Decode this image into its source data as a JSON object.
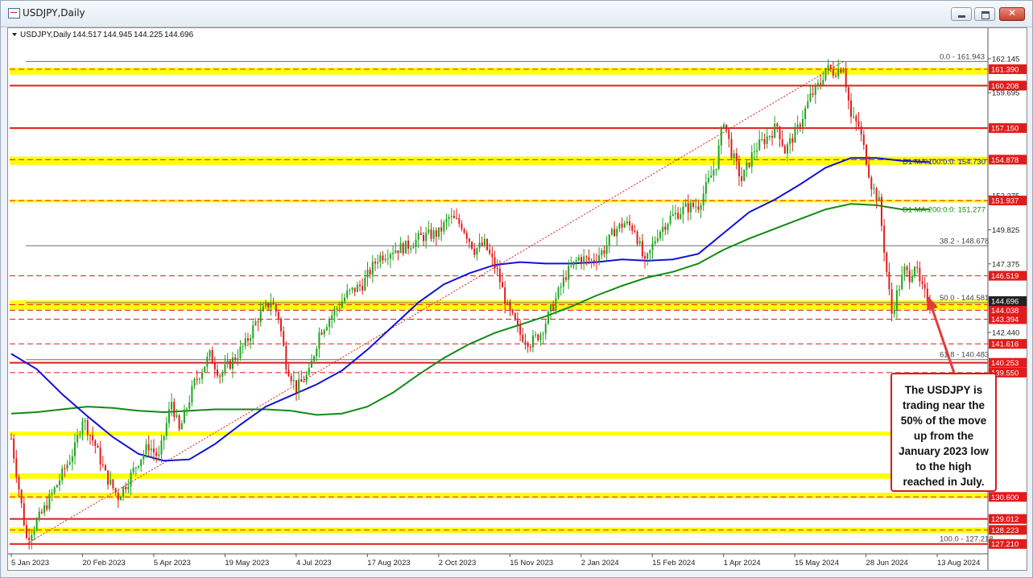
{
  "window": {
    "title": "USDJPY,Daily",
    "controls": {
      "minimize": "minimize",
      "maximize": "maximize",
      "close": "✕"
    }
  },
  "chart_data": {
    "type": "candlestick",
    "symbol": "USDJPY,Daily",
    "ohlc_header": [
      "144.517",
      "144.945",
      "144.225",
      "144.696"
    ],
    "colors": {
      "up": "#1fa41f",
      "down": "#e01b1b",
      "ma100": "#1212d6",
      "ma200": "#138a13",
      "hline": "#e41a1a",
      "zone": "#ffff00",
      "fib": "#6e6e6e"
    },
    "x_ticks": [
      "5 Jan 2023",
      "20 Feb 2023",
      "5 Apr 2023",
      "19 May 2023",
      "4 Jul 2023",
      "17 Aug 2023",
      "2 Oct 2023",
      "15 Nov 2023",
      "2 Jan 2024",
      "15 Feb 2024",
      "1 Apr 2024",
      "15 May 2024",
      "28 Jun 2024",
      "13 Aug 2024"
    ],
    "y_ticks": [
      "162.145",
      "159.695",
      "152.275",
      "149.825",
      "147.375",
      "142.440"
    ],
    "ylim": [
      126.5,
      163.3
    ],
    "price_path": [
      {
        "t": 0,
        "p": 134.8
      },
      {
        "t": 3,
        "p": 131.2
      },
      {
        "t": 6,
        "p": 127.6
      },
      {
        "t": 12,
        "p": 129.4
      },
      {
        "t": 18,
        "p": 131.5
      },
      {
        "t": 25,
        "p": 134.1
      },
      {
        "t": 28,
        "p": 136.3
      },
      {
        "t": 33,
        "p": 134.3
      },
      {
        "t": 37,
        "p": 132.2
      },
      {
        "t": 42,
        "p": 130.6
      },
      {
        "t": 46,
        "p": 131.8
      },
      {
        "t": 50,
        "p": 133.2
      },
      {
        "t": 54,
        "p": 134.3
      },
      {
        "t": 58,
        "p": 133.4
      },
      {
        "t": 63,
        "p": 137.5
      },
      {
        "t": 66,
        "p": 135.3
      },
      {
        "t": 72,
        "p": 138.8
      },
      {
        "t": 78,
        "p": 140.8
      },
      {
        "t": 82,
        "p": 139.4
      },
      {
        "t": 86,
        "p": 140.2
      },
      {
        "t": 92,
        "p": 141.6
      },
      {
        "t": 97,
        "p": 143.5
      },
      {
        "t": 102,
        "p": 144.7
      },
      {
        "t": 105,
        "p": 143.6
      },
      {
        "t": 108,
        "p": 140.2
      },
      {
        "t": 112,
        "p": 138.4
      },
      {
        "t": 117,
        "p": 139.5
      },
      {
        "t": 121,
        "p": 142.4
      },
      {
        "t": 126,
        "p": 143.7
      },
      {
        "t": 132,
        "p": 145.2
      },
      {
        "t": 138,
        "p": 145.9
      },
      {
        "t": 144,
        "p": 147.8
      },
      {
        "t": 150,
        "p": 148.4
      },
      {
        "t": 155,
        "p": 148.6
      },
      {
        "t": 161,
        "p": 149.3
      },
      {
        "t": 168,
        "p": 149.6
      },
      {
        "t": 172,
        "p": 150.7
      },
      {
        "t": 177,
        "p": 150.2
      },
      {
        "t": 182,
        "p": 148.4
      },
      {
        "t": 186,
        "p": 148.8
      },
      {
        "t": 191,
        "p": 146.8
      },
      {
        "t": 195,
        "p": 144.2
      },
      {
        "t": 200,
        "p": 142.3
      },
      {
        "t": 204,
        "p": 141.7
      },
      {
        "t": 208,
        "p": 142.4
      },
      {
        "t": 213,
        "p": 144.4
      },
      {
        "t": 218,
        "p": 146.6
      },
      {
        "t": 223,
        "p": 147.8
      },
      {
        "t": 228,
        "p": 147.6
      },
      {
        "t": 233,
        "p": 148.4
      },
      {
        "t": 237,
        "p": 149.8
      },
      {
        "t": 241,
        "p": 150.3
      },
      {
        "t": 245,
        "p": 149.9
      },
      {
        "t": 249,
        "p": 147.3
      },
      {
        "t": 254,
        "p": 149.6
      },
      {
        "t": 259,
        "p": 150.7
      },
      {
        "t": 265,
        "p": 151.4
      },
      {
        "t": 270,
        "p": 151.6
      },
      {
        "t": 274,
        "p": 153.3
      },
      {
        "t": 277,
        "p": 154.6
      },
      {
        "t": 280,
        "p": 157.8
      },
      {
        "t": 283,
        "p": 155.4
      },
      {
        "t": 287,
        "p": 153.4
      },
      {
        "t": 292,
        "p": 155.6
      },
      {
        "t": 297,
        "p": 156.5
      },
      {
        "t": 301,
        "p": 157.3
      },
      {
        "t": 304,
        "p": 155.5
      },
      {
        "t": 309,
        "p": 157.1
      },
      {
        "t": 314,
        "p": 159.4
      },
      {
        "t": 318,
        "p": 160.4
      },
      {
        "t": 320,
        "p": 161.5
      },
      {
        "t": 323,
        "p": 161.2
      },
      {
        "t": 327,
        "p": 161.6
      },
      {
        "t": 330,
        "p": 157.9
      },
      {
        "t": 333,
        "p": 157.3
      },
      {
        "t": 336,
        "p": 154.9
      },
      {
        "t": 338,
        "p": 153.1
      },
      {
        "t": 341,
        "p": 151.8
      },
      {
        "t": 344,
        "p": 146.8
      },
      {
        "t": 346,
        "p": 143.8
      },
      {
        "t": 348,
        "p": 145.2
      },
      {
        "t": 351,
        "p": 146.9
      },
      {
        "t": 353,
        "p": 146.5
      },
      {
        "t": 355,
        "p": 147.4
      },
      {
        "t": 357,
        "p": 145.9
      },
      {
        "t": 359,
        "p": 145.2
      },
      {
        "t": 361,
        "p": 144.7
      }
    ],
    "ma100": [
      {
        "t": 0,
        "p": 140.9
      },
      {
        "t": 10,
        "p": 139.8
      },
      {
        "t": 20,
        "p": 138.0
      },
      {
        "t": 30,
        "p": 136.4
      },
      {
        "t": 40,
        "p": 134.9
      },
      {
        "t": 50,
        "p": 133.7
      },
      {
        "t": 60,
        "p": 133.2
      },
      {
        "t": 70,
        "p": 133.3
      },
      {
        "t": 80,
        "p": 134.4
      },
      {
        "t": 90,
        "p": 135.8
      },
      {
        "t": 100,
        "p": 137.1
      },
      {
        "t": 110,
        "p": 137.9
      },
      {
        "t": 120,
        "p": 138.7
      },
      {
        "t": 130,
        "p": 139.7
      },
      {
        "t": 140,
        "p": 141.2
      },
      {
        "t": 150,
        "p": 142.9
      },
      {
        "t": 160,
        "p": 144.6
      },
      {
        "t": 170,
        "p": 145.9
      },
      {
        "t": 180,
        "p": 146.7
      },
      {
        "t": 190,
        "p": 147.3
      },
      {
        "t": 200,
        "p": 147.5
      },
      {
        "t": 210,
        "p": 147.4
      },
      {
        "t": 220,
        "p": 147.4
      },
      {
        "t": 230,
        "p": 147.5
      },
      {
        "t": 240,
        "p": 147.7
      },
      {
        "t": 250,
        "p": 147.6
      },
      {
        "t": 260,
        "p": 147.7
      },
      {
        "t": 270,
        "p": 148.1
      },
      {
        "t": 280,
        "p": 149.6
      },
      {
        "t": 290,
        "p": 151.1
      },
      {
        "t": 300,
        "p": 152.0
      },
      {
        "t": 310,
        "p": 153.1
      },
      {
        "t": 320,
        "p": 154.3
      },
      {
        "t": 330,
        "p": 155.0
      },
      {
        "t": 340,
        "p": 155.0
      },
      {
        "t": 350,
        "p": 154.8
      },
      {
        "t": 361,
        "p": 154.7
      }
    ],
    "ma200": [
      {
        "t": 0,
        "p": 136.6
      },
      {
        "t": 10,
        "p": 136.7
      },
      {
        "t": 20,
        "p": 136.9
      },
      {
        "t": 30,
        "p": 137.1
      },
      {
        "t": 40,
        "p": 137.0
      },
      {
        "t": 50,
        "p": 136.8
      },
      {
        "t": 60,
        "p": 136.7
      },
      {
        "t": 70,
        "p": 136.8
      },
      {
        "t": 80,
        "p": 136.9
      },
      {
        "t": 90,
        "p": 136.9
      },
      {
        "t": 100,
        "p": 136.9
      },
      {
        "t": 110,
        "p": 136.8
      },
      {
        "t": 120,
        "p": 136.5
      },
      {
        "t": 130,
        "p": 136.6
      },
      {
        "t": 140,
        "p": 137.1
      },
      {
        "t": 150,
        "p": 138.1
      },
      {
        "t": 160,
        "p": 139.4
      },
      {
        "t": 170,
        "p": 140.6
      },
      {
        "t": 180,
        "p": 141.6
      },
      {
        "t": 190,
        "p": 142.4
      },
      {
        "t": 200,
        "p": 143.0
      },
      {
        "t": 210,
        "p": 143.6
      },
      {
        "t": 220,
        "p": 144.3
      },
      {
        "t": 230,
        "p": 145.1
      },
      {
        "t": 240,
        "p": 145.8
      },
      {
        "t": 250,
        "p": 146.4
      },
      {
        "t": 260,
        "p": 146.8
      },
      {
        "t": 270,
        "p": 147.4
      },
      {
        "t": 280,
        "p": 148.4
      },
      {
        "t": 290,
        "p": 149.2
      },
      {
        "t": 300,
        "p": 149.9
      },
      {
        "t": 310,
        "p": 150.6
      },
      {
        "t": 320,
        "p": 151.3
      },
      {
        "t": 330,
        "p": 151.7
      },
      {
        "t": 340,
        "p": 151.6
      },
      {
        "t": 350,
        "p": 151.3
      },
      {
        "t": 361,
        "p": 151.3
      }
    ],
    "horizontal_lines": [
      {
        "price": 161.39,
        "label": "161.390",
        "style": "dashed"
      },
      {
        "price": 160.208,
        "label": "160.208",
        "style": "solid"
      },
      {
        "price": 157.15,
        "label": "157.150",
        "style": "solid"
      },
      {
        "price": 154.878,
        "label": "154.878",
        "style": "dashed"
      },
      {
        "price": 151.937,
        "label": "151.937",
        "style": "dashed"
      },
      {
        "price": 146.519,
        "label": "146.519",
        "style": "dashed"
      },
      {
        "price": 144.447,
        "label": "144.447",
        "style": "dashed"
      },
      {
        "price": 144.038,
        "label": "144.038",
        "style": "dashed"
      },
      {
        "price": 143.394,
        "label": "143.394",
        "style": "dashed"
      },
      {
        "price": 141.616,
        "label": "141.616",
        "style": "dashed"
      },
      {
        "price": 140.253,
        "label": "140.253",
        "style": "solid"
      },
      {
        "price": 139.55,
        "label": "139.550",
        "style": "dashed"
      },
      {
        "price": 130.6,
        "label": "130.600",
        "style": "dashed"
      },
      {
        "price": 129.012,
        "label": "129.012",
        "style": "solid"
      },
      {
        "price": 128.223,
        "label": "128.223",
        "style": "dashed"
      },
      {
        "price": 127.21,
        "label": "127.210",
        "style": "solid"
      }
    ],
    "zones": [
      {
        "from": 161.0,
        "to": 161.5
      },
      {
        "from": 154.5,
        "to": 155.1
      },
      {
        "from": 151.8,
        "to": 152.0
      },
      {
        "from": 144.05,
        "to": 144.75
      },
      {
        "from": 135.0,
        "to": 135.3
      },
      {
        "from": 131.9,
        "to": 132.3
      },
      {
        "from": 130.5,
        "to": 130.9
      },
      {
        "from": 128.0,
        "to": 128.4
      }
    ],
    "fib_levels": [
      {
        "price": 161.943,
        "label": "0.0 - 161.943"
      },
      {
        "price": 148.678,
        "label": "38.2 - 148.678"
      },
      {
        "price": 144.581,
        "label": "50.0 - 144.581"
      },
      {
        "price": 140.483,
        "label": "61.8 - 140.483"
      },
      {
        "price": 127.218,
        "label": "100.0 - 127.218"
      }
    ],
    "ma_labels": [
      {
        "text": "D1 MA:100:0:0: 154.730",
        "price": 154.73
      },
      {
        "text": "D1 MA:200:0:0: 151.277",
        "price": 151.277
      }
    ],
    "price_badge": "144.696",
    "annotation": "The USDJPY is trading near the 50% of the move up from the January 2023 low to the high reached in July."
  }
}
